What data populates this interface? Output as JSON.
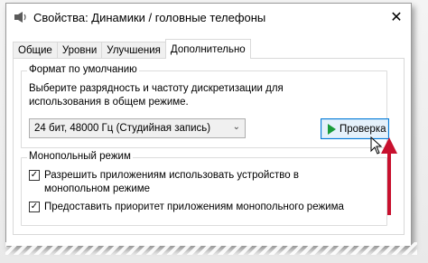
{
  "window": {
    "title": "Свойства: Динамики / головные телефоны",
    "close_symbol": "✕"
  },
  "tabs": [
    {
      "label": "Общие",
      "active": false
    },
    {
      "label": "Уровни",
      "active": false
    },
    {
      "label": "Улучшения",
      "active": false
    },
    {
      "label": "Дополнительно",
      "active": true
    }
  ],
  "default_format": {
    "legend": "Формат по умолчанию",
    "description": "Выберите разрядность и частоту дискретизации для использования в общем режиме.",
    "selected_value": "24 бит, 48000 Гц (Студийная запись)",
    "test_button": "Проверка"
  },
  "exclusive_mode": {
    "legend": "Монопольный режим",
    "options": [
      {
        "label": "Разрешить приложениям использовать устройство в монопольном режиме",
        "checked": true
      },
      {
        "label": "Предоставить приоритет приложениям монопольного режима",
        "checked": true
      }
    ]
  },
  "colors": {
    "accent_blue": "#0078d7",
    "play_green": "#1a9c3a",
    "annotation_red": "#c8102e"
  }
}
